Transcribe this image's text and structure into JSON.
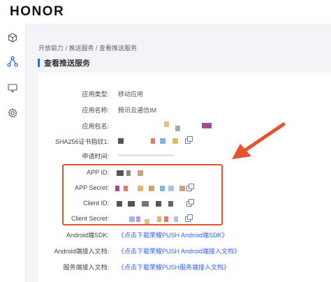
{
  "brand": {
    "logo_text": "HONOR"
  },
  "sidebar": {
    "icons": [
      "cube-icon",
      "share-nodes-icon",
      "monitor-icon",
      "gear-icon"
    ],
    "active_index": 1,
    "accent_color": "#2f63f6"
  },
  "breadcrumb": {
    "text": "开放能力 / 推送服务 / 查看推送服务"
  },
  "page": {
    "title": "查看推送服务"
  },
  "fields": {
    "app_type": {
      "label": "应用类型:",
      "value": "移动应用"
    },
    "app_name": {
      "label": "应用名称:",
      "value": "腾讯云通信IM"
    },
    "package_name": {
      "label": "应用包名:"
    },
    "sha256": {
      "label": "SHA256证书指纹1:"
    },
    "apply_time": {
      "label": "申请时间:"
    },
    "app_id": {
      "label": "APP ID:"
    },
    "app_secret": {
      "label": "APP Secret:"
    },
    "client_id": {
      "label": "Client ID:"
    },
    "client_secret": {
      "label": "Client Secret:"
    }
  },
  "docs": {
    "android_sdk": {
      "label": "Android端SDK:",
      "link": "《点击下载荣耀PUSH Android端SDK》"
    },
    "android_guide": {
      "label": "Android端接入文档:",
      "link": "《点击下载荣耀PUSH Android端接入文档》"
    },
    "server_guide": {
      "label": "服务端接入文档:",
      "link": "《点击下载荣耀PUSH服务端接入文档》"
    }
  },
  "highlight_color": "#e6532c"
}
